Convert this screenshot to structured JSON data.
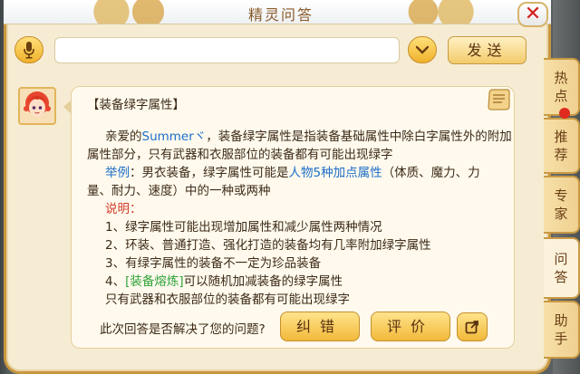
{
  "window": {
    "title": "精灵问答"
  },
  "toolbar": {
    "input_placeholder": "",
    "send_label": "发送"
  },
  "message": {
    "heading": "【装备绿字属性】",
    "intro_before": "亲爱的",
    "user_name": "Summerヾ",
    "intro_after": "，装备绿字属性是指装备基础属性中除白字属性外的附加",
    "intro_line2": "属性部分，只有武器和衣服部位的装备都有可能出现绿字",
    "example_label": "举例",
    "example_text_a": "：男衣装备，绿字属性可能是",
    "example_highlight": "人物5种加点属性",
    "example_text_b": "（体质、魔力、力",
    "example_line2": "量、耐力、速度）中的一种或两种",
    "notes_label": "说明：",
    "note1": "1、绿字属性可能出现增加属性和减少属性两种情况",
    "note2": "2、环装、普通打造、强化打造的装备均有几率附加绿字属性",
    "note3": "3、有绿字属性的装备不一定为珍品装备",
    "note4_prefix": "4、",
    "note4_link": "[装备熔炼]",
    "note4_suffix": "可以随机加减装备的绿字属性",
    "closing": "只有武器和衣服部位的装备都有可能出现绿字"
  },
  "feedback": {
    "question": "此次回答是否解决了您的问题?",
    "correct_label": "纠错",
    "rate_label": "评价"
  },
  "tabs": [
    {
      "label_1": "热",
      "label_2": "点"
    },
    {
      "label_1": "推",
      "label_2": "荐"
    },
    {
      "label_1": "专",
      "label_2": "家"
    },
    {
      "label_1": "问",
      "label_2": "答"
    },
    {
      "label_1": "助",
      "label_2": "手"
    }
  ],
  "colors": {
    "accent": "#f2b93a",
    "link_blue": "#1e6dc9",
    "label_red": "#d23b2b",
    "link_green": "#2fa33a",
    "close_red": "#d21d1d"
  },
  "icons": [
    "microphone-icon",
    "chevron-down-icon",
    "close-icon",
    "scroll-icon",
    "share-icon",
    "notification-dot"
  ]
}
